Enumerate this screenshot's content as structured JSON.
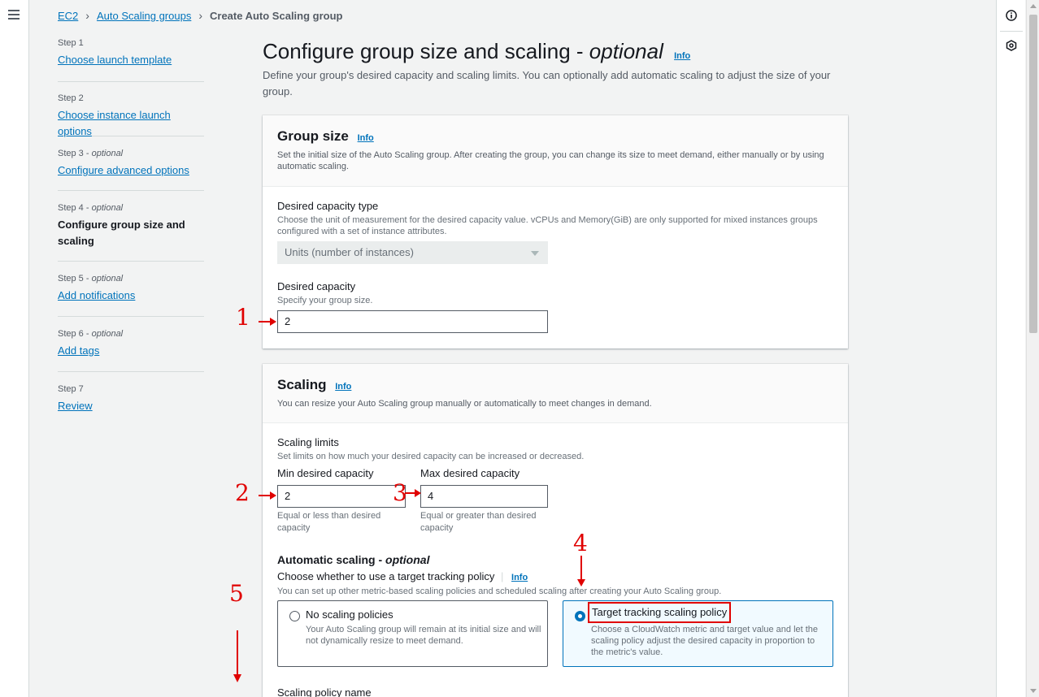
{
  "breadcrumb": {
    "items": [
      "EC2",
      "Auto Scaling groups"
    ],
    "current": "Create Auto Scaling group"
  },
  "steps": [
    {
      "label": "Step 1",
      "optional": "",
      "title": "Choose launch template",
      "active": false
    },
    {
      "label": "Step 2",
      "optional": "",
      "title": "Choose instance launch options",
      "active": false
    },
    {
      "label": "Step 3",
      "optional": "optional",
      "title": "Configure advanced options",
      "active": false
    },
    {
      "label": "Step 4",
      "optional": "optional",
      "title": "Configure group size and scaling",
      "active": true
    },
    {
      "label": "Step 5",
      "optional": "optional",
      "title": "Add notifications",
      "active": false
    },
    {
      "label": "Step 6",
      "optional": "optional",
      "title": "Add tags",
      "active": false
    },
    {
      "label": "Step 7",
      "optional": "",
      "title": "Review",
      "active": false
    }
  ],
  "page": {
    "title": "Configure group size and scaling - ",
    "title_optional": "optional",
    "info": "Info",
    "description": "Define your group's desired capacity and scaling limits. You can optionally add automatic scaling to adjust the size of your group."
  },
  "group_size": {
    "title": "Group size",
    "info": "Info",
    "description": "Set the initial size of the Auto Scaling group. After creating the group, you can change its size to meet demand, either manually or by using automatic scaling.",
    "capacity_type_label": "Desired capacity type",
    "capacity_type_desc": "Choose the unit of measurement for the desired capacity value. vCPUs and Memory(GiB) are only supported for mixed instances groups configured with a set of instance attributes.",
    "capacity_type_value": "Units (number of instances)",
    "desired_label": "Desired capacity",
    "desired_desc": "Specify your group size.",
    "desired_value": "2"
  },
  "scaling": {
    "title": "Scaling",
    "info": "Info",
    "description": "You can resize your Auto Scaling group manually or automatically to meet changes in demand.",
    "limits_label": "Scaling limits",
    "limits_desc": "Set limits on how much your desired capacity can be increased or decreased.",
    "min_label": "Min desired capacity",
    "min_value": "2",
    "min_constraint": "Equal or less than desired capacity",
    "max_label": "Max desired capacity",
    "max_value": "4",
    "max_constraint": "Equal or greater than desired capacity",
    "auto_title": "Automatic scaling - ",
    "auto_optional": "optional",
    "choose_label": "Choose whether to use a target tracking policy",
    "choose_info": "Info",
    "choose_desc": "You can set up other metric-based scaling policies and scheduled scaling after creating your Auto Scaling group.",
    "option_none_title": "No scaling policies",
    "option_none_desc": "Your Auto Scaling group will remain at its initial size and will not dynamically resize to meet demand.",
    "option_target_title": "Target tracking scaling policy",
    "option_target_desc": "Choose a CloudWatch metric and target value and let the scaling policy adjust the desired capacity in proportion to the metric's value.",
    "selected_option": "target",
    "policy_name_label": "Scaling policy name"
  },
  "annotations": [
    "1",
    "2",
    "3",
    "4",
    "5"
  ],
  "colors": {
    "link": "#0073bb",
    "annotation": "#e00000",
    "selected_tile_bg": "#f1faff"
  },
  "icons": [
    "menu-icon",
    "info-circle-icon",
    "settings-hex-icon",
    "chevron-right-icon",
    "caret-down-icon"
  ]
}
